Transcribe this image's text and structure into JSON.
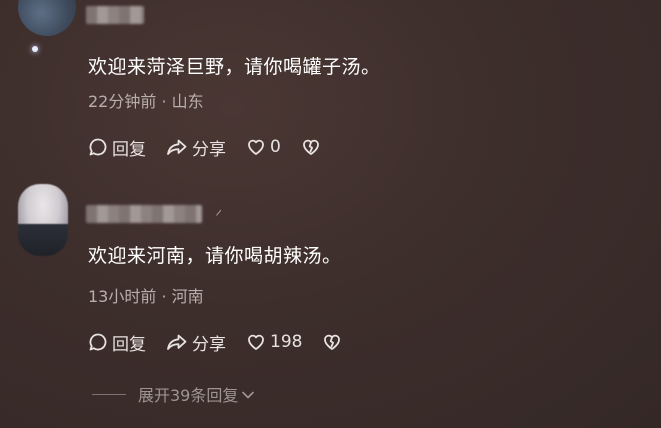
{
  "comments": [
    {
      "text": "欢迎来菏泽巨野，请你喝罐子汤。",
      "time": "22分钟前",
      "separator": "·",
      "location": "山东",
      "reply_label": "回复",
      "share_label": "分享",
      "like_count": "0"
    },
    {
      "text": "欢迎来河南，请你喝胡辣汤。",
      "time": "13小时前",
      "separator": "·",
      "location": "河南",
      "reply_label": "回复",
      "share_label": "分享",
      "like_count": "198"
    }
  ],
  "expand_replies_label": "展开39条回复",
  "icons": {
    "reply": "reply-icon",
    "share": "share-icon",
    "like": "heart-icon",
    "dislike": "broken-heart-icon",
    "expand": "chevron-down-icon"
  },
  "colors": {
    "background": "#3d2e2b",
    "text": "#ffffff",
    "meta_text": "#b8aeab",
    "action_text": "#e8e2e0"
  }
}
